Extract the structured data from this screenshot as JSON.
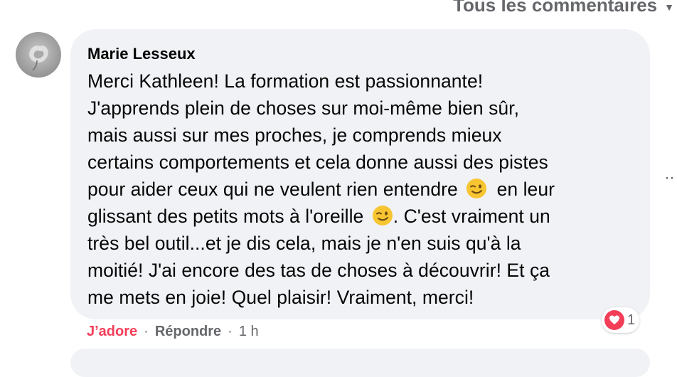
{
  "header": {
    "filter_label": "Tous les commentaires",
    "chevron_icon": "chevron-down-icon"
  },
  "comment": {
    "author": "Marie Lesseux",
    "avatar_icon": "avatar-flower-photo",
    "lines": [
      "Merci Kathleen! La formation est passionnante!",
      "J'apprends plein de choses sur moi-même bien sûr,",
      "mais aussi sur mes proches, je comprends mieux",
      "certains comportements et cela donne aussi des pistes"
    ],
    "line5_before": "pour aider ceux qui ne veulent rien entendre",
    "line5_after": "en leur",
    "line6_before": "glissant des petits mots à l'oreille",
    "line6_after": ". C'est vraiment un",
    "lines_end": [
      "très bel outil...et je dis cela, mais je n'en suis qu'à la",
      "moitié! J'ai encore des tas de choses à découvrir! Et ça",
      "me mets en joie! Quel plaisir! Vraiment, merci!"
    ],
    "emoji_icon": "wink-emoji-icon"
  },
  "actions": {
    "reaction_label": "J’adore",
    "separator": "·",
    "reply_label": "Répondre",
    "time": "1 h"
  },
  "reactions": {
    "icon": "heart-reaction-icon",
    "count": "1"
  },
  "more_options": "··",
  "colors": {
    "bubble": "#f0f2f5",
    "love": "#f33e58",
    "secondary_text": "#65676b"
  }
}
